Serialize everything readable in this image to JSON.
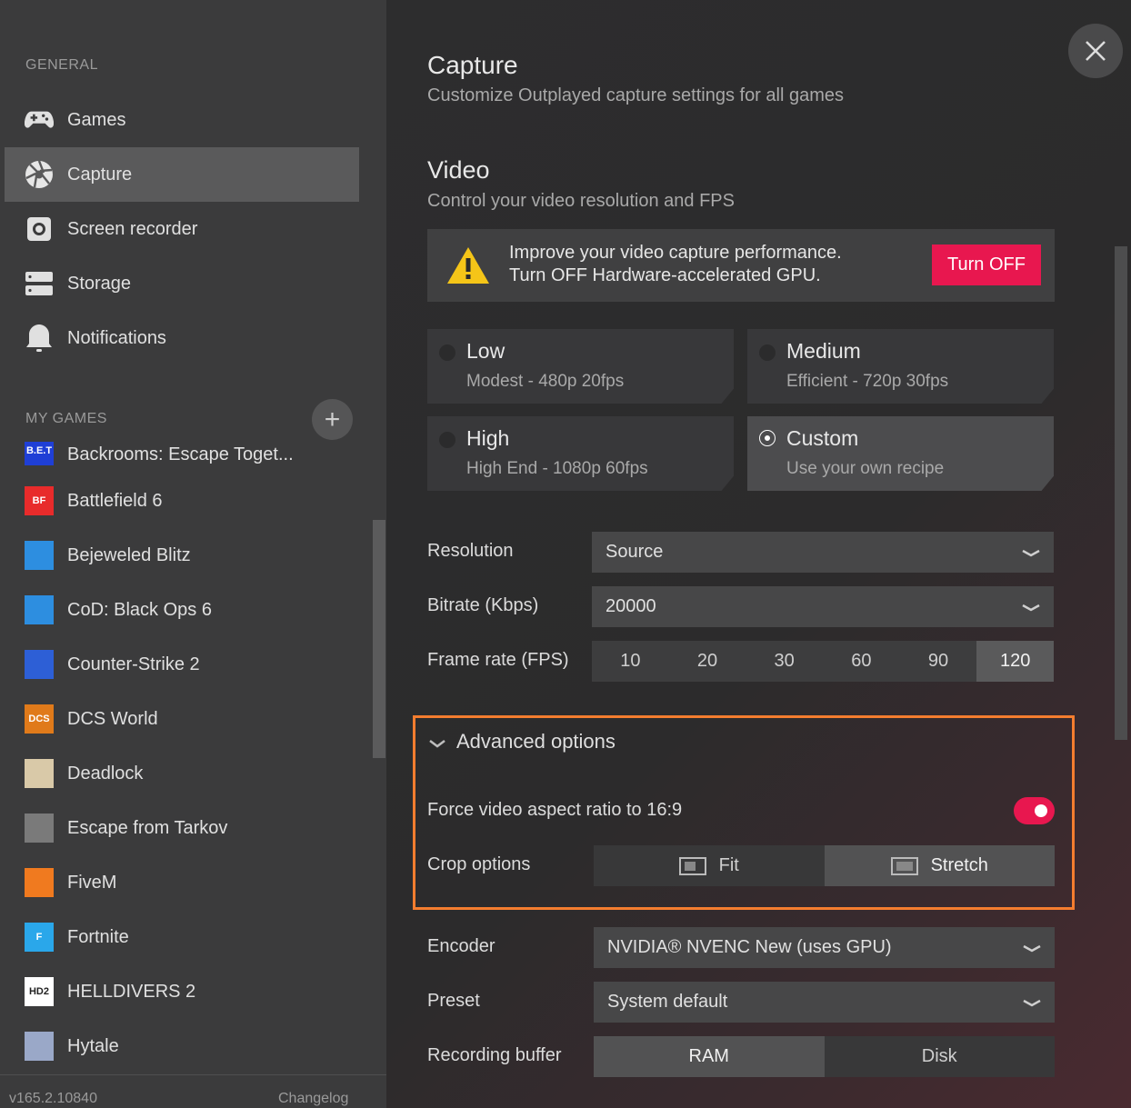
{
  "sidebar": {
    "general_label": "GENERAL",
    "nav": [
      {
        "label": "Games",
        "icon": "gamepad-icon"
      },
      {
        "label": "Capture",
        "icon": "aperture-icon"
      },
      {
        "label": "Screen recorder",
        "icon": "record-icon"
      },
      {
        "label": "Storage",
        "icon": "storage-icon"
      },
      {
        "label": "Notifications",
        "icon": "bell-icon"
      }
    ],
    "my_games_label": "MY GAMES",
    "add_label": "+",
    "games": [
      {
        "label": "Backrooms: Escape Toget...",
        "icon_text": "B.E.T",
        "color": "#1f3fd6"
      },
      {
        "label": "Battlefield 6",
        "icon_text": "BF",
        "color": "#e82b2b"
      },
      {
        "label": "Bejeweled Blitz",
        "icon_text": "",
        "color": "#2d8ee0"
      },
      {
        "label": "CoD: Black Ops 6",
        "icon_text": "",
        "color": "#2d8ee0"
      },
      {
        "label": "Counter-Strike 2",
        "icon_text": "",
        "color": "#2d5fd6"
      },
      {
        "label": "DCS World",
        "icon_text": "DCS",
        "color": "#e07a1a"
      },
      {
        "label": "Deadlock",
        "icon_text": "",
        "color": "#d9c9a8"
      },
      {
        "label": "Escape from Tarkov",
        "icon_text": "",
        "color": "#7a7a7a"
      },
      {
        "label": "FiveM",
        "icon_text": "",
        "color": "#f07a1f"
      },
      {
        "label": "Fortnite",
        "icon_text": "F",
        "color": "#2aa7ea"
      },
      {
        "label": "HELLDIVERS 2",
        "icon_text": "HD2",
        "color": "#ffffff"
      },
      {
        "label": "Hytale",
        "icon_text": "",
        "color": "#9aa8c8"
      }
    ],
    "version": "v165.2.10840",
    "changelog": "Changelog"
  },
  "main": {
    "title": "Capture",
    "subtitle": "Customize Outplayed capture settings for all games",
    "video_title": "Video",
    "video_subtitle": "Control your video resolution and FPS",
    "warning": {
      "line1": "Improve your video capture performance.",
      "line2": "Turn OFF Hardware-accelerated GPU.",
      "button": "Turn OFF"
    },
    "presets": [
      {
        "title": "Low",
        "desc": "Modest - 480p 20fps",
        "selected": false
      },
      {
        "title": "Medium",
        "desc": "Efficient - 720p 30fps",
        "selected": false
      },
      {
        "title": "High",
        "desc": "High End - 1080p 60fps",
        "selected": false
      },
      {
        "title": "Custom",
        "desc": "Use your own recipe",
        "selected": true
      }
    ],
    "resolution_label": "Resolution",
    "resolution_value": "Source",
    "bitrate_label": "Bitrate (Kbps)",
    "bitrate_value": "20000",
    "fps_label": "Frame rate (FPS)",
    "fps_options": [
      "10",
      "20",
      "30",
      "60",
      "90",
      "120"
    ],
    "fps_selected": "120",
    "advanced_title": "Advanced options",
    "force_aspect_label": "Force video aspect ratio to 16:9",
    "force_aspect_on": true,
    "crop_label": "Crop options",
    "crop_options": [
      "Fit",
      "Stretch"
    ],
    "crop_selected": "Stretch",
    "encoder_label": "Encoder",
    "encoder_value": "NVIDIA® NVENC New (uses GPU)",
    "preset_label": "Preset",
    "preset_value": "System default",
    "buffer_label": "Recording buffer",
    "buffer_options": [
      "RAM",
      "Disk"
    ],
    "buffer_selected": "RAM"
  },
  "colors": {
    "accent": "#e8174f",
    "highlight_border": "#f47d2f"
  }
}
